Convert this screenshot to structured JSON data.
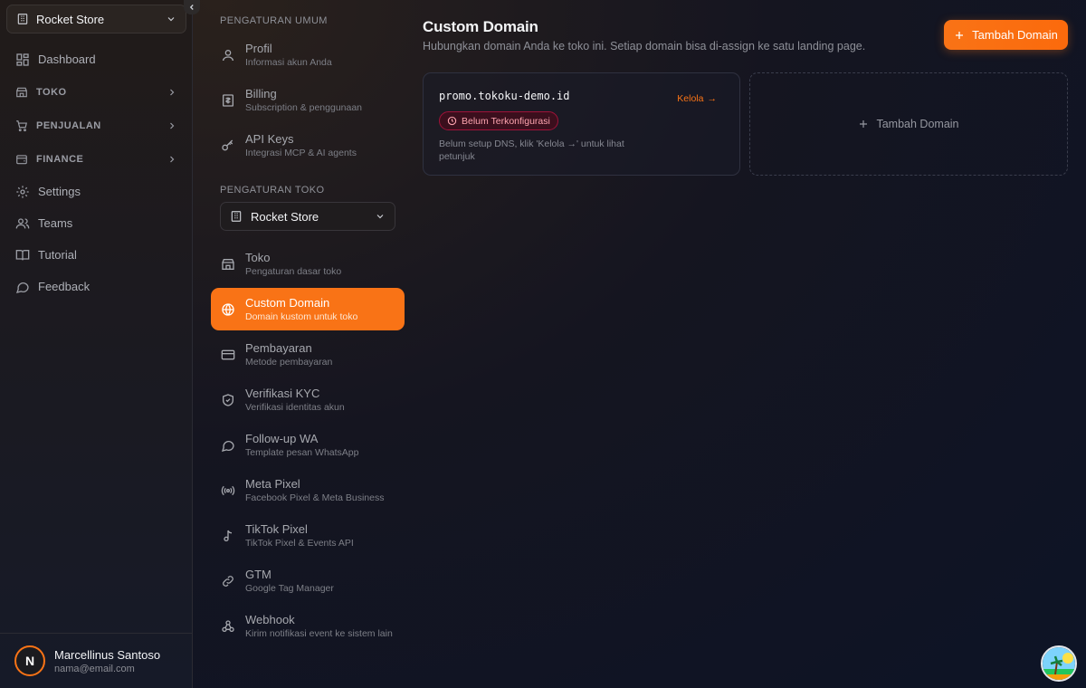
{
  "sidebar": {
    "store_switcher": "Rocket Store",
    "items": [
      {
        "label": "Dashboard",
        "icon": "dashboard-icon"
      },
      {
        "label": "TOKO",
        "icon": "store-icon"
      },
      {
        "label": "PENJUALAN",
        "icon": "cart-icon"
      },
      {
        "label": "FINANCE",
        "icon": "wallet-icon"
      },
      {
        "label": "Settings",
        "icon": "gear-icon"
      },
      {
        "label": "Teams",
        "icon": "users-icon"
      },
      {
        "label": "Tutorial",
        "icon": "book-icon"
      },
      {
        "label": "Feedback",
        "icon": "chat-icon"
      }
    ],
    "user": {
      "initial": "N",
      "name": "Marcellinus Santoso",
      "email": "nama@email.com"
    }
  },
  "settings": {
    "general_label": "PENGATURAN UMUM",
    "general": [
      {
        "title": "Profil",
        "sub": "Informasi akun Anda"
      },
      {
        "title": "Billing",
        "sub": "Subscription & penggunaan"
      },
      {
        "title": "API Keys",
        "sub": "Integrasi MCP & AI agents"
      }
    ],
    "store_label": "PENGATURAN TOKO",
    "store_select": "Rocket Store",
    "store": [
      {
        "title": "Toko",
        "sub": "Pengaturan dasar toko"
      },
      {
        "title": "Custom Domain",
        "sub": "Domain kustom untuk toko"
      },
      {
        "title": "Pembayaran",
        "sub": "Metode pembayaran"
      },
      {
        "title": "Verifikasi KYC",
        "sub": "Verifikasi identitas akun"
      },
      {
        "title": "Follow-up WA",
        "sub": "Template pesan WhatsApp"
      },
      {
        "title": "Meta Pixel",
        "sub": "Facebook Pixel & Meta Business"
      },
      {
        "title": "TikTok Pixel",
        "sub": "TikTok Pixel & Events API"
      },
      {
        "title": "GTM",
        "sub": "Google Tag Manager"
      },
      {
        "title": "Webhook",
        "sub": "Kirim notifikasi event ke sistem lain"
      }
    ]
  },
  "main": {
    "title": "Custom Domain",
    "subtitle": "Hubungkan domain Anda ke toko ini. Setiap domain bisa di-assign ke satu landing page.",
    "add_button": "Tambah Domain",
    "domain": {
      "name": "promo.tokoku-demo.id",
      "manage": "Kelola",
      "status": "Belum Terkonfigurasi",
      "hint": "Belum setup DNS, klik 'Kelola →' untuk lihat petunjuk"
    },
    "add_card": "Tambah Domain"
  },
  "colors": {
    "accent": "#f97316",
    "badge_bg": "#3b0f1d",
    "badge_text": "#fda4af"
  }
}
